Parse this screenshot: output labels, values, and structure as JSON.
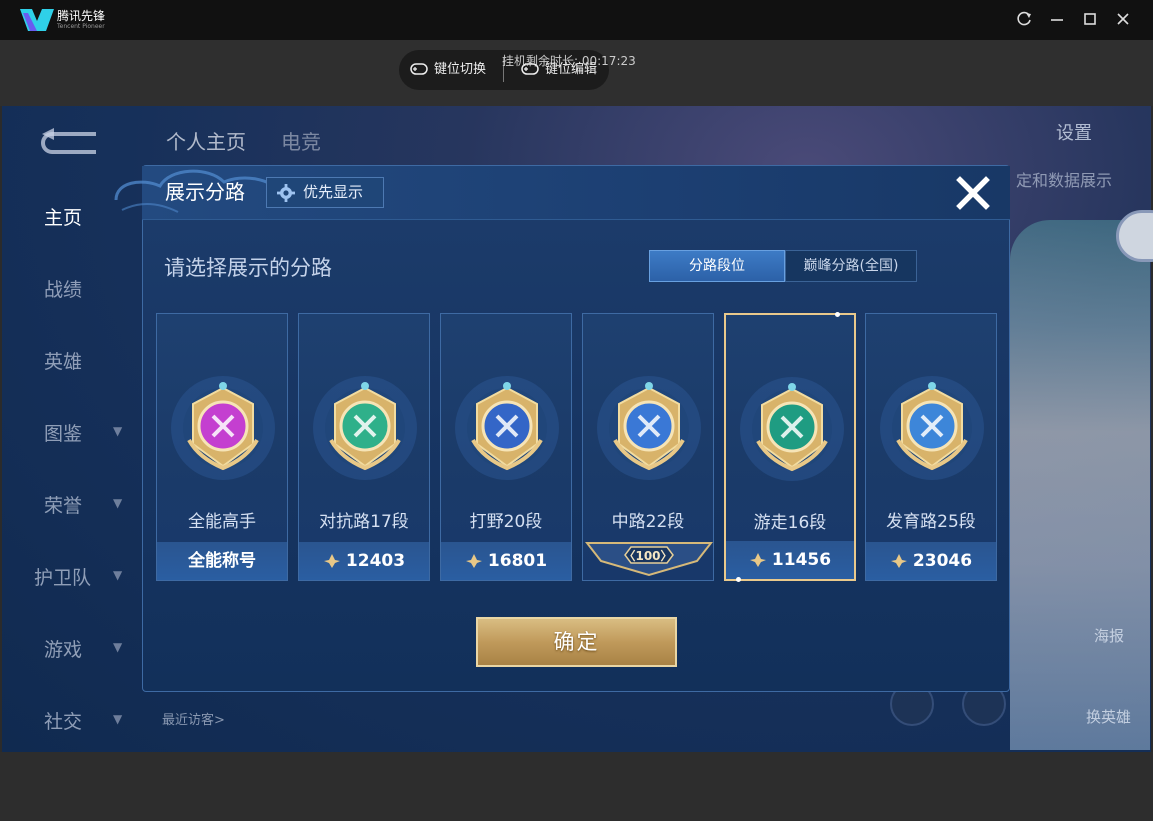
{
  "titlebar": {
    "app_name": "腾讯先锋",
    "app_subtitle": "Tencent Pioneer",
    "icons": [
      "refresh-icon",
      "minimize-icon",
      "maximize-icon",
      "close-icon"
    ]
  },
  "toolbar": {
    "key_switch_label": "键位切换",
    "key_edit_label": "键位编辑",
    "timer_text": "挂机剩余时长: 00:17:23"
  },
  "game_bg": {
    "tabs": [
      "个人主页",
      "电竞"
    ],
    "sidebar": [
      "主页",
      "战绩",
      "英雄",
      "图鉴",
      "荣誉",
      "护卫队",
      "游戏",
      "社交"
    ],
    "settings_label": "设置",
    "right_text": "定和数据展示",
    "poster_label": "海报",
    "switch_hero_label": "换英雄",
    "recent_visitors": "最近访客>"
  },
  "modal": {
    "title": "展示分路",
    "priority_button": "优先显示",
    "prompt": "请选择展示的分路",
    "segments": [
      "分路段位",
      "巅峰分路(全国)"
    ],
    "active_segment": 0,
    "confirm_label": "确定",
    "cards": [
      {
        "name": "全能高手",
        "bottom_text": "全能称号",
        "type": "title",
        "color": "#c43fd0"
      },
      {
        "name": "对抗路17段",
        "bottom_text": "12403",
        "type": "score",
        "color": "#2fb08a"
      },
      {
        "name": "打野20段",
        "bottom_text": "16801",
        "type": "score",
        "color": "#3466c7"
      },
      {
        "name": "中路22段",
        "bottom_text": "100",
        "type": "badge",
        "color": "#3a78d6"
      },
      {
        "name": "游走16段",
        "bottom_text": "11456",
        "type": "score",
        "color": "#1f9c82"
      },
      {
        "name": "发育路25段",
        "bottom_text": "23046",
        "type": "score",
        "color": "#3d86d9"
      }
    ],
    "selected_index": 4
  },
  "colors": {
    "gold": "#e9c98c",
    "modal_bg": "#1b3b69",
    "accent_blue": "#3d7bc6"
  }
}
